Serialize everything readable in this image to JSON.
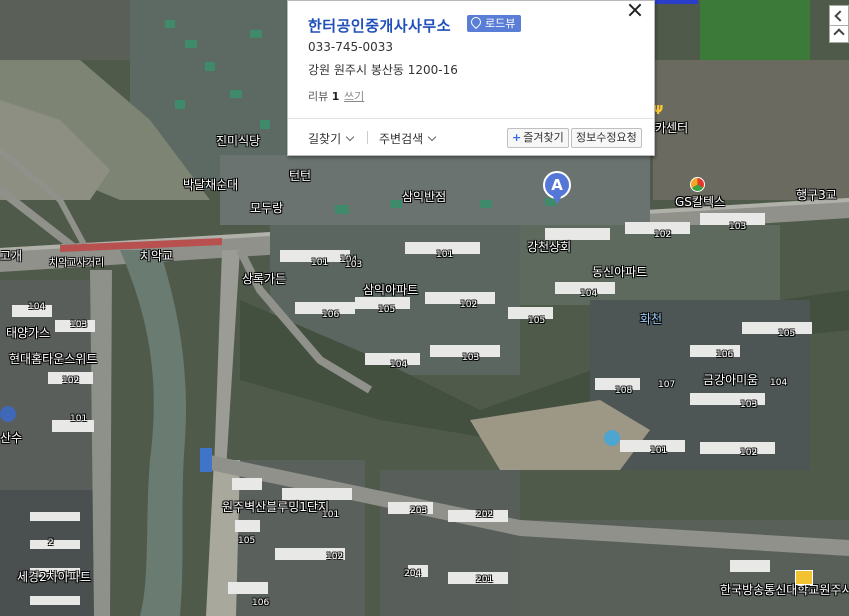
{
  "place": {
    "title": "한터공인중개사사무소",
    "roadview_label": "로드뷰",
    "phone": "033-745-0033",
    "address": "강원 원주시 봉산동 1200-16",
    "review_label": "리뷰",
    "review_count": "1",
    "write_label": "쓰기",
    "directions_label": "길찾기",
    "nearby_label": "주변검색",
    "favorite_label": "즐겨찾기",
    "edit_label": "정보수정요청"
  },
  "marker": {
    "letter": "A",
    "color": "#5477d8"
  },
  "colors": {
    "title": "#1f4fb8",
    "roadview_badge": "#5a7ed6",
    "top_bar": "#2b3ec9"
  },
  "labels": {
    "jinmi": "진미식당",
    "bakdal": "박달채순대",
    "teonteo": "턴턴",
    "morang": "모두랑",
    "samik_banjeom": "삼익반점",
    "center": "카센터",
    "gs": "GS칼텍스",
    "haenggu": "행구3교",
    "gangcheon": "강천상회",
    "dongsin_apt": "동신아파트",
    "chiak": "치악교",
    "chiak_sageori": "치악교사거리",
    "gogae": "고개",
    "sangrok": "상록가든",
    "samik_apt": "삼익아파트",
    "taeyang": "태양가스",
    "hyundai": "현대홈타운스위트",
    "hwacheon": "화천",
    "geumgang": "금강아미움",
    "sansu": "산수",
    "byeoksan": "원주벽산블루밍1단지",
    "segyeong": "세경2차아파트",
    "college": "한국방송통신대학교원주시"
  },
  "bldg_nums": {
    "n101a": "101",
    "n102a": "102",
    "n103a": "103",
    "n104a": "104",
    "n105a": "105",
    "n106a": "106",
    "n101b": "101",
    "n102b": "102",
    "n103b": "103",
    "n104b": "104",
    "n105b": "105",
    "n106b": "106",
    "n107b": "107",
    "n108b": "108",
    "n101c": "101",
    "n102c": "102",
    "n103c": "103",
    "n104c": "104",
    "n104d": "104",
    "n103d": "103",
    "n101d": "101",
    "n105d": "105",
    "n2": "2",
    "n203": "203",
    "n202": "202",
    "n204": "204",
    "n201": "201",
    "n105e": "105",
    "n102e": "102",
    "n106e": "106",
    "n101e": "101",
    "n102f": "102"
  }
}
